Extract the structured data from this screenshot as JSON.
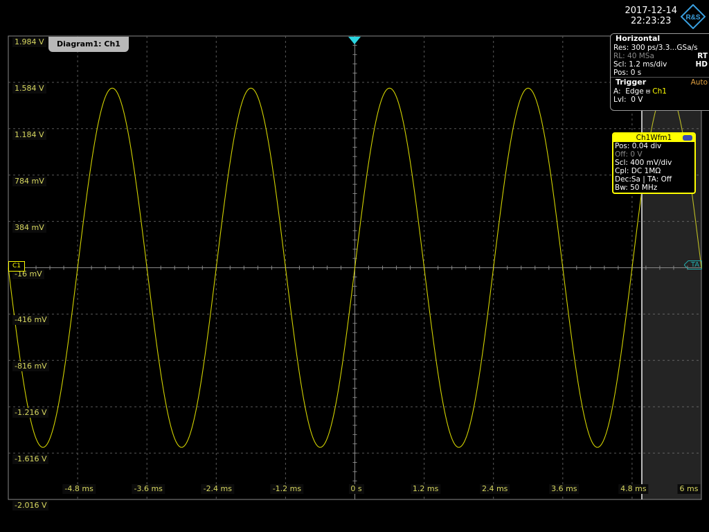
{
  "header": {
    "date": "2017-12-14",
    "time": "22:23:23",
    "logo_icon": "rs-logo-icon",
    "logo_text": "R&S"
  },
  "diagram": {
    "title": "Diagram1: Ch1"
  },
  "horizontal_panel": {
    "title": "Horizontal",
    "rows": [
      {
        "key": "Res:",
        "value": "300 ps/3.3...GSa/s",
        "badge": ""
      },
      {
        "key": "RL:",
        "value": "40 MSa",
        "badge": "RT"
      },
      {
        "key": "Scl:",
        "value": "1.2 ms/div",
        "badge": "HD"
      },
      {
        "key": "Pos:",
        "value": "0 s",
        "badge": ""
      }
    ],
    "trigger_title": "Trigger",
    "trigger_mode": "Auto",
    "trigger_rows": [
      {
        "key": "A:",
        "value": "Edge",
        "source": "Ch1"
      },
      {
        "key": "Lvl:",
        "value": "0 V",
        "source": ""
      }
    ]
  },
  "channel_panel": {
    "title": "Ch1Wfm1",
    "rows": [
      "Pos: 0.04 div",
      "Off: 0 V",
      "Scl: 400 mV/div",
      "Cpl: DC 1MΩ",
      "Dec:Sa | TA: Off",
      "Bw: 50 MHz"
    ]
  },
  "markers": {
    "channel": "C1",
    "ta": "TA"
  },
  "y_labels": [
    "1.984 V",
    "1.584 V",
    "1.184 V",
    "784 mV",
    "384 mV",
    "-16 mV",
    "-416 mV",
    "-816 mV",
    "-1.216 V",
    "-1.616 V",
    "-2.016 V"
  ],
  "x_labels": [
    "-4.8 ms",
    "-3.6 ms",
    "-2.4 ms",
    "-1.2 ms",
    "0 s",
    "1.2 ms",
    "2.4 ms",
    "3.6 ms",
    "4.8 ms",
    "6 ms"
  ],
  "colors": {
    "trace": "#d4d400",
    "grid": "#5a5a5a",
    "label": "#d8d860",
    "trigger_marker": "#2ad4e0"
  },
  "chart_data": {
    "type": "line",
    "x_range_ms": [
      -6,
      6
    ],
    "y_range_V": [
      -2.016,
      1.984
    ],
    "series": [
      {
        "waveform": "sine",
        "amplitude_V": 1.55,
        "period_ms": 2.4,
        "offset_V": -0.016,
        "phase_at_zero": "rising zero crossing"
      }
    ]
  }
}
